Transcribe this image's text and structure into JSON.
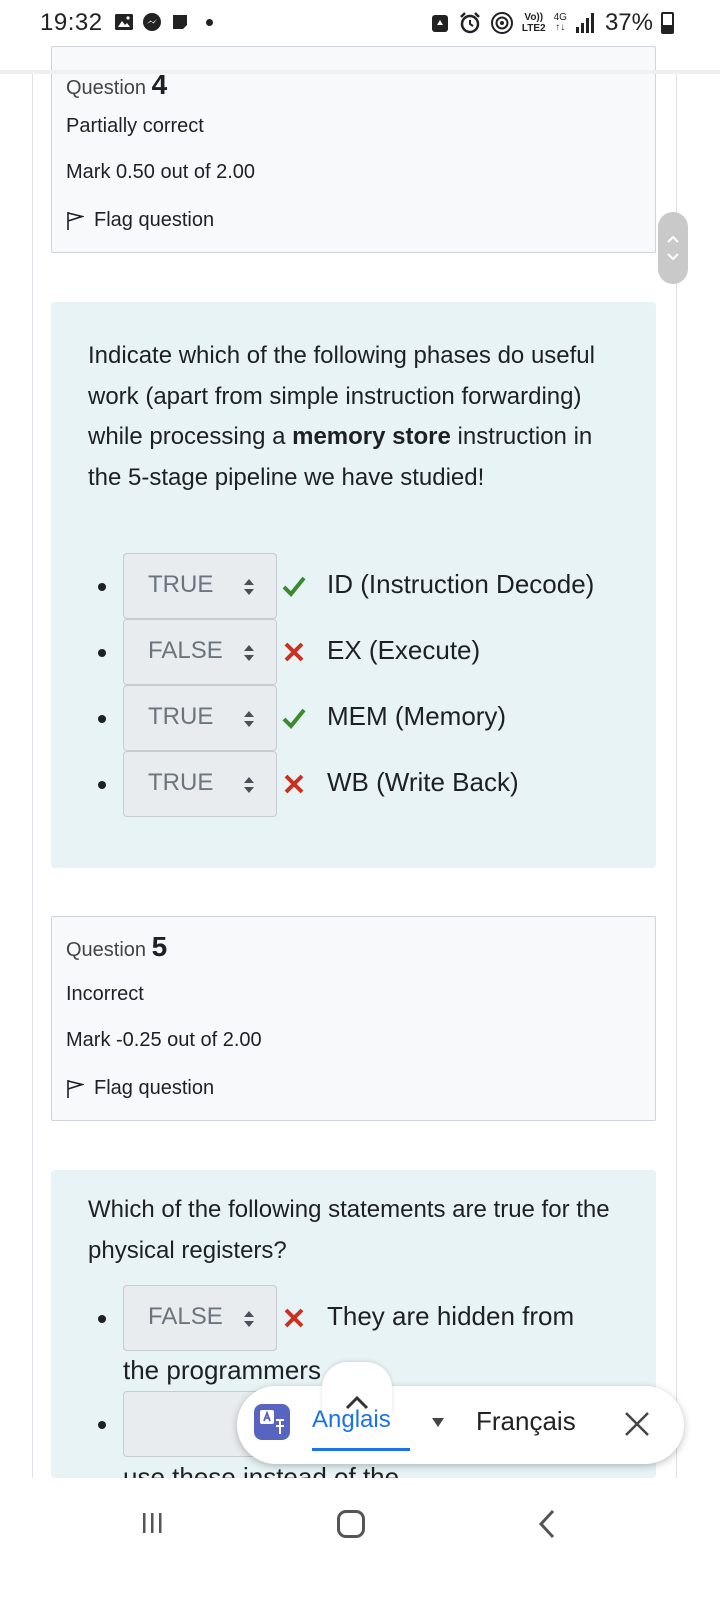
{
  "status_bar": {
    "time": "19:32",
    "volte_top": "Vo))",
    "volte_bottom": "LTE2",
    "network": "4G",
    "battery": "37%"
  },
  "question4": {
    "label": "Question",
    "number": "4",
    "state": "Partially correct",
    "grade": "Mark 0.50 out of 2.00",
    "flag_label": "Flag question",
    "text_before_bold": "Indicate which of the following phases do useful work (apart from simple instruction forwarding) while processing a ",
    "text_bold": "memory store",
    "text_after_bold": " instruction in the 5-stage pipeline we have studied!",
    "answers": [
      {
        "value": "TRUE",
        "status": "correct",
        "label": "ID (Instruction Decode)"
      },
      {
        "value": "FALSE",
        "status": "incorrect",
        "label": "EX (Execute)"
      },
      {
        "value": "TRUE",
        "status": "correct",
        "label": "MEM (Memory)"
      },
      {
        "value": "TRUE",
        "status": "incorrect",
        "label": "WB (Write Back)"
      }
    ]
  },
  "question5": {
    "label": "Question",
    "number": "5",
    "state": "Incorrect",
    "grade": "Mark -0.25 out of 2.00",
    "flag_label": "Flag question",
    "text": "Which of the following statements are true for the physical registers?",
    "answers": [
      {
        "value": "FALSE",
        "status": "incorrect",
        "label_line1": "They are hidden from",
        "label_line2": "the programmers"
      },
      {
        "value": "",
        "status": "",
        "label_line1": "",
        "label_line2": "use these instead of the"
      }
    ]
  },
  "translate_bar": {
    "source_language": "Anglais",
    "target_language": "Français"
  },
  "colors": {
    "correct": "#3c8a2e",
    "incorrect": "#ca3120",
    "question_bg": "#e7f3f5",
    "info_bg": "#f8f9fa",
    "translate_blue": "#1a73e8"
  }
}
